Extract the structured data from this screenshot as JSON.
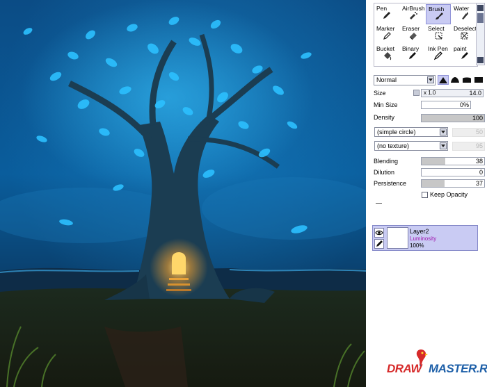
{
  "tools": [
    {
      "label": "Pen",
      "icon": "pen-icon",
      "selected": false
    },
    {
      "label": "AirBrush",
      "icon": "airbrush-icon",
      "selected": false
    },
    {
      "label": "Brush",
      "icon": "brush-icon",
      "selected": true
    },
    {
      "label": "Water",
      "icon": "water-icon",
      "selected": false
    },
    {
      "label": "Marker",
      "icon": "marker-icon",
      "selected": false
    },
    {
      "label": "Eraser",
      "icon": "eraser-icon",
      "selected": false
    },
    {
      "label": "Select",
      "icon": "select-icon",
      "selected": false
    },
    {
      "label": "Deselect",
      "icon": "deselect-icon",
      "selected": false
    },
    {
      "label": "Bucket",
      "icon": "bucket-icon",
      "selected": false
    },
    {
      "label": "Binary",
      "icon": "binary-icon",
      "selected": false
    },
    {
      "label": "Ink Pen",
      "icon": "ink-pen-icon",
      "selected": false
    },
    {
      "label": "paint",
      "icon": "paint-icon",
      "selected": false
    }
  ],
  "brush_settings": {
    "blend_mode": "Normal",
    "size_label": "Size",
    "size_multiplier": "x 1.0",
    "size_value": "14.0",
    "min_size_label": "Min Size",
    "min_size_value": "0%",
    "density_label": "Density",
    "density_value": "100",
    "density_level": 1.0,
    "shape_option": "(simple circle)",
    "shape_value": "50",
    "texture_option": "(no texture)",
    "texture_value": "95",
    "blending_label": "Blending",
    "blending_value": "38",
    "blending_level": 0.38,
    "dilution_label": "Dilution",
    "dilution_value": "0",
    "dilution_level": 0.0,
    "persistence_label": "Persistence",
    "persistence_value": "37",
    "persistence_level": 0.37,
    "keep_opacity_label": "Keep Opacity",
    "keep_opacity_checked": false
  },
  "layer": {
    "name": "Layer2",
    "mode": "Luminosity",
    "opacity": "100%"
  },
  "watermark": {
    "part1": "DRAW",
    "part2": "MASTER.RU"
  },
  "colors": {
    "selection": "#c9cbf3",
    "layer_mode": "#a01ab0",
    "watermark_red": "#d62a2a",
    "watermark_blue": "#1d5fa8"
  }
}
